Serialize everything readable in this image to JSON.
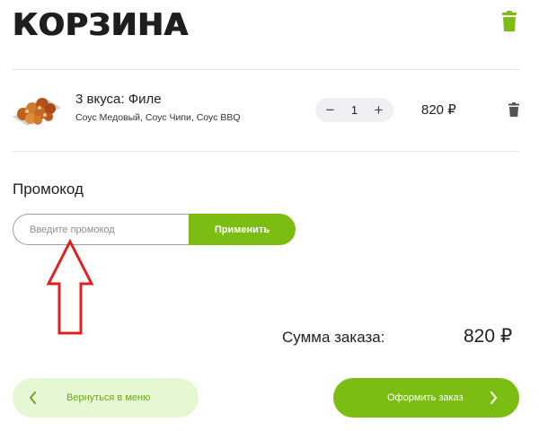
{
  "header": {
    "title": "КОРЗИНА",
    "clear_icon": "trash-icon"
  },
  "cart_item": {
    "name": "3 вкуса: Филе",
    "sauces": "Соус Медовый, Соус Чипи, Соус BBQ",
    "image_icon": "chicken-wings-plate",
    "quantity": "1",
    "minus_label": "−",
    "plus_label": "+",
    "price": "820 ₽",
    "delete_icon": "trash-icon"
  },
  "promo": {
    "heading": "Промокод",
    "placeholder": "Введите промокод",
    "value": "",
    "apply_label": "Применить"
  },
  "summary": {
    "label": "Сумма заказа:",
    "total": "820 ₽"
  },
  "actions": {
    "back_label": "Вернуться в меню",
    "checkout_label": "Оформить заказ",
    "back_icon": "chevron-left-icon",
    "checkout_icon": "chevron-right-icon"
  },
  "colors": {
    "accent": "#7cbd13",
    "accent_light": "#e6f7d4",
    "annotation": "#e02020",
    "stepper_bg": "#eff0f3",
    "trash_header": "#7cbd13",
    "trash_item": "#555555"
  }
}
